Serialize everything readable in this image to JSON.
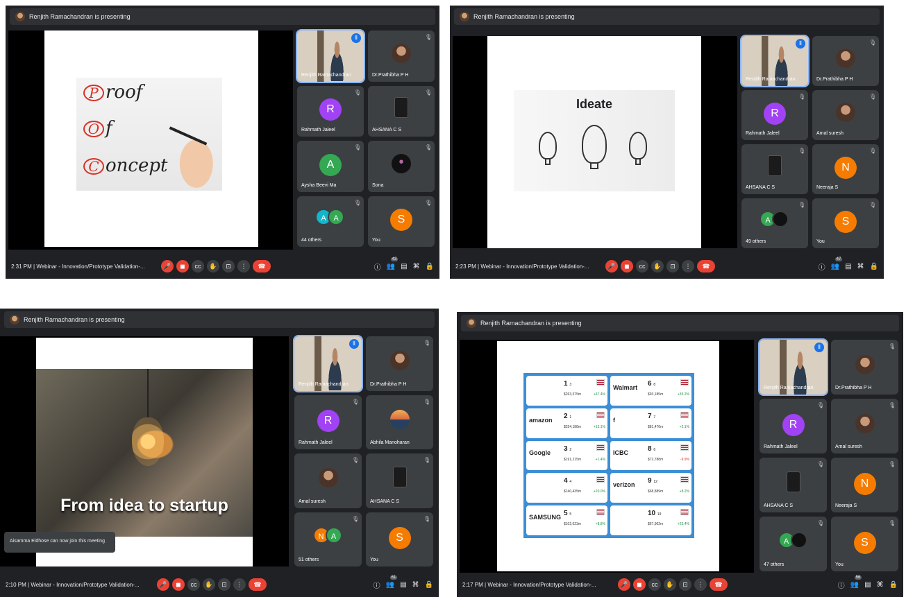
{
  "banner": "Renjith Ramachandran is presenting",
  "meeting_title": "Webinar - Innovation/Prototype Validation-...",
  "shots": [
    {
      "time": "2:31 PM",
      "participant_count": "43",
      "slide": {
        "type": "poc",
        "letters": [
          "P",
          "O",
          "C"
        ],
        "words": [
          "roof",
          "f",
          "oncept"
        ]
      },
      "tiles": [
        {
          "name": "Renjith Ramachandran",
          "kind": "video",
          "active": true
        },
        {
          "name": "Dr.Prathibha P H",
          "kind": "photo"
        },
        {
          "name": "Rahmath Jaleel",
          "kind": "letter",
          "letter": "R",
          "color": "#a142f4"
        },
        {
          "name": "AHSANA C S",
          "kind": "phone"
        },
        {
          "name": "Aysha Beevi Ma",
          "kind": "letter",
          "letter": "A",
          "color": "#34a853"
        },
        {
          "name": "Sona",
          "kind": "dark"
        },
        {
          "name": "44 others",
          "kind": "pair",
          "pair": [
            "A",
            "A"
          ],
          "colors": [
            "#12b5cb",
            "#34a853"
          ]
        },
        {
          "name": "You",
          "kind": "letter",
          "letter": "S",
          "color": "#f57c00"
        }
      ]
    },
    {
      "time": "2:23 PM",
      "participant_count": "47",
      "slide": {
        "type": "ideate",
        "title": "Ideate"
      },
      "tiles": [
        {
          "name": "Renjith Ramachandran",
          "kind": "video",
          "active": true
        },
        {
          "name": "Dr.Prathibha P H",
          "kind": "photo"
        },
        {
          "name": "Rahmath Jaleel",
          "kind": "letter",
          "letter": "R",
          "color": "#a142f4"
        },
        {
          "name": "Amal suresh",
          "kind": "photo"
        },
        {
          "name": "AHSANA C S",
          "kind": "phone"
        },
        {
          "name": "Neeraja S",
          "kind": "letter",
          "letter": "N",
          "color": "#f57c00"
        },
        {
          "name": "49 others",
          "kind": "pair",
          "pair": [
            "A",
            ""
          ],
          "colors": [
            "#34a853",
            "#111111"
          ]
        },
        {
          "name": "You",
          "kind": "letter",
          "letter": "S",
          "color": "#f57c00"
        }
      ]
    },
    {
      "time": "2:10 PM",
      "participant_count": "61",
      "slide": {
        "type": "startup",
        "caption": "From idea to startup"
      },
      "toast": "Aisamma Eldhose can now join this meeting",
      "tiles": [
        {
          "name": "Renjith Ramachandran",
          "kind": "video",
          "active": true
        },
        {
          "name": "Dr.Prathibha P H",
          "kind": "photo"
        },
        {
          "name": "Rahmath Jaleel",
          "kind": "letter",
          "letter": "R",
          "color": "#a142f4"
        },
        {
          "name": "Abhila Manoharan",
          "kind": "sunset"
        },
        {
          "name": "Amal suresh",
          "kind": "photo"
        },
        {
          "name": "AHSANA C S",
          "kind": "phone"
        },
        {
          "name": "51 others",
          "kind": "pair",
          "pair": [
            "N",
            "A"
          ],
          "colors": [
            "#f57c00",
            "#34a853"
          ]
        },
        {
          "name": "You",
          "kind": "letter",
          "letter": "S",
          "color": "#f57c00"
        }
      ]
    },
    {
      "time": "2:17 PM",
      "participant_count": "56",
      "slide": {
        "type": "brands",
        "items": [
          {
            "logo": "",
            "rank": "1",
            "prev": "3",
            "value": "$263,375m",
            "pct": "+67.4%",
            "neg": false
          },
          {
            "logo": "Walmart",
            "rank": "6",
            "prev": "8",
            "value": "$93,185m",
            "pct": "+35.2%",
            "neg": false
          },
          {
            "logo": "amazon",
            "rank": "2",
            "prev": "1",
            "value": "$254,188m",
            "pct": "+15.1%",
            "neg": false
          },
          {
            "logo": "f",
            "rank": "7",
            "prev": "7",
            "value": "$81,476m",
            "pct": "+2.1%",
            "neg": false
          },
          {
            "logo": "Google",
            "rank": "3",
            "prev": "2",
            "value": "$191,215m",
            "pct": "+1.4%",
            "neg": false
          },
          {
            "logo": "ICBC",
            "rank": "8",
            "prev": "6",
            "value": "$72,788m",
            "pct": "-9.9%",
            "neg": true
          },
          {
            "logo": "",
            "rank": "4",
            "prev": "4",
            "value": "$140,435m",
            "pct": "+20.0%",
            "neg": false
          },
          {
            "logo": "verizon",
            "rank": "9",
            "prev": "12",
            "value": "$68,889m",
            "pct": "+8.2%",
            "neg": false
          },
          {
            "logo": "SAMSUNG",
            "rank": "5",
            "prev": "5",
            "value": "$102,623m",
            "pct": "+8.8%",
            "neg": false
          },
          {
            "logo": "",
            "rank": "10",
            "prev": "19",
            "value": "$67,902m",
            "pct": "+25.4%",
            "neg": false
          }
        ]
      },
      "tiles": [
        {
          "name": "Renjith Ramachandran",
          "kind": "video",
          "active": true
        },
        {
          "name": "Dr.Prathibha P H",
          "kind": "photo"
        },
        {
          "name": "Rahmath Jaleel",
          "kind": "letter",
          "letter": "R",
          "color": "#a142f4"
        },
        {
          "name": "Amal suresh",
          "kind": "photo"
        },
        {
          "name": "AHSANA C S",
          "kind": "phone"
        },
        {
          "name": "Neeraja S",
          "kind": "letter",
          "letter": "N",
          "color": "#f57c00"
        },
        {
          "name": "47 others",
          "kind": "pair",
          "pair": [
            "A",
            ""
          ],
          "colors": [
            "#34a853",
            "#111111"
          ]
        },
        {
          "name": "You",
          "kind": "letter",
          "letter": "S",
          "color": "#f57c00"
        }
      ]
    }
  ]
}
